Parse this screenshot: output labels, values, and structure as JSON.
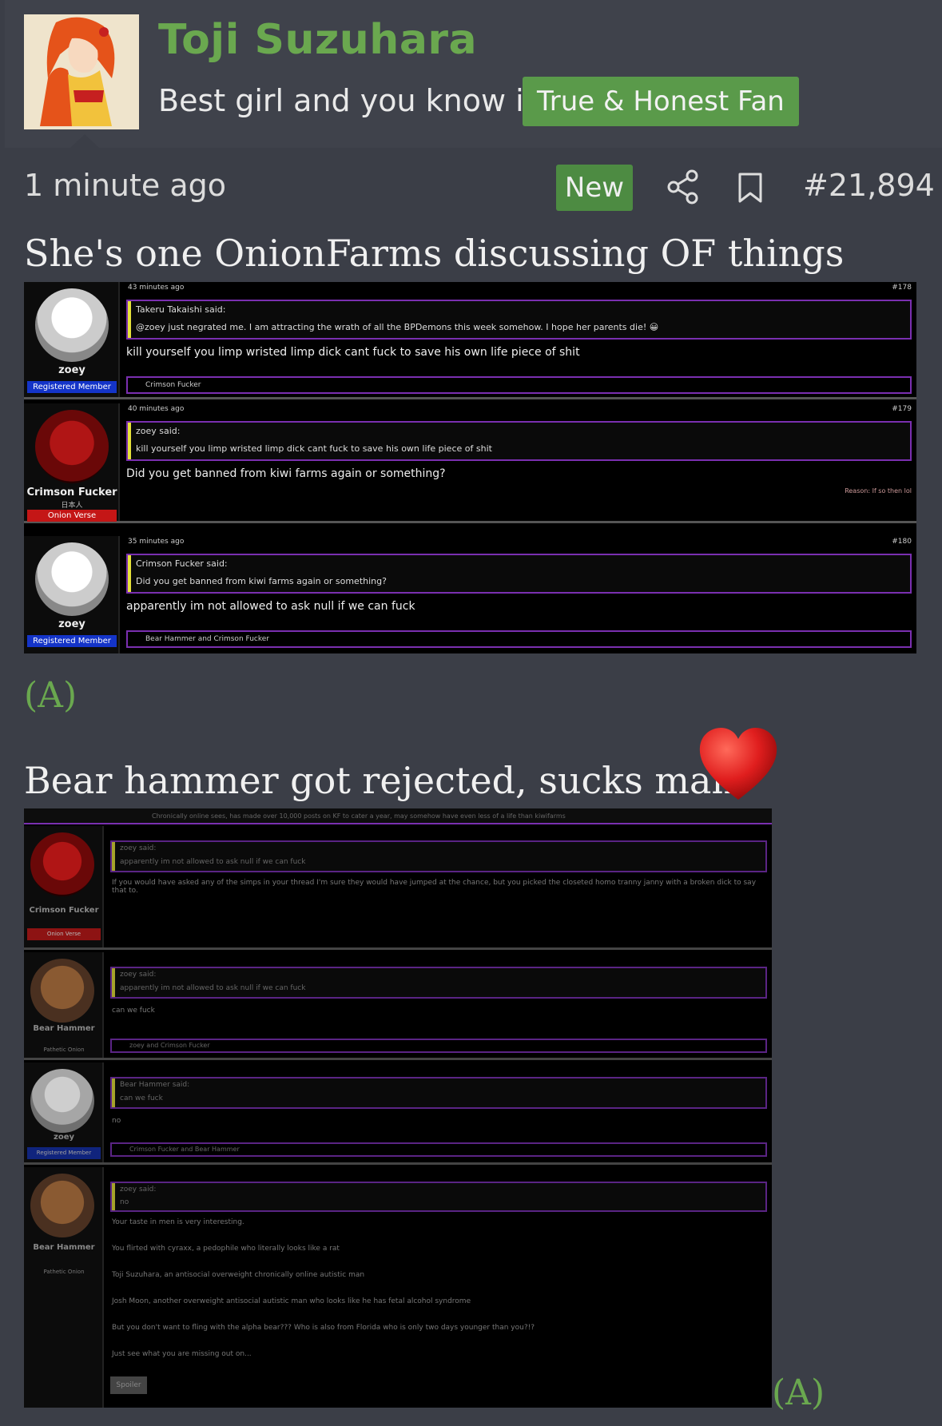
{
  "header": {
    "username": "Toji Suzuhara",
    "user_title": "Best girl and you know it",
    "user_banner": "True & Honest Fan"
  },
  "post": {
    "timestamp": "1 minute ago",
    "new_badge": "New",
    "post_number": "#21,894",
    "line1": "She's one OnionFarms discussing OF things",
    "marker": "(A)",
    "line2": "Bear hammer got rejected, sucks man"
  },
  "screenshot1": {
    "posts": [
      {
        "time": "43 minutes ago",
        "number": "#178",
        "user": "zoey",
        "badge": "Registered Member",
        "quote_author": "Takeru Takaishi said:",
        "quote_text": "@zoey just negrated me. I am attracting the wrath of all the BPDemons this week somehow. I hope her parents die! 😀",
        "text": "kill yourself you limp wristed limp dick cant fuck to save his own life piece of shit",
        "reactions": "Crimson Fucker"
      },
      {
        "time": "40 minutes ago",
        "number": "#179",
        "user": "Crimson Fucker",
        "user_sub": "日本人",
        "badge": "Onion Verse",
        "quote_author": "zoey said:",
        "quote_text": "kill yourself you limp wristed limp dick cant fuck to save his own life piece of shit",
        "text": "Did you get banned from kiwi farms again or something?",
        "reason": "Reason: If so then lol"
      },
      {
        "time": "35 minutes ago",
        "number": "#180",
        "user": "zoey",
        "badge": "Registered Member",
        "quote_author": "Crimson Fucker said:",
        "quote_text": "Did you get banned from kiwi farms again or something?",
        "text": "apparently im not allowed to ask null if we can fuck",
        "reactions": "Bear Hammer and Crimson Fucker"
      }
    ]
  },
  "screenshot2": {
    "top_bar": "Chronically online sees, has made over 10,000 posts on KF to cater a year, may somehow have even less of a life than kiwifarms",
    "posts": [
      {
        "user": "Crimson Fucker",
        "badge": "Onion Verse",
        "quote_author": "zoey said:",
        "quote_text": "apparently im not allowed to ask null if we can fuck",
        "text": "If you would have asked any of the simps in your thread I'm sure they would have jumped at the chance, but you picked the closeted homo tranny janny with a broken dick to say that to."
      },
      {
        "user": "Bear Hammer",
        "badge": "Pathetic Onion",
        "quote_author": "zoey said:",
        "quote_text": "apparently im not allowed to ask null if we can fuck",
        "text": "can we fuck",
        "reactions": "zoey and Crimson Fucker"
      },
      {
        "user": "zoey",
        "badge": "Registered Member",
        "quote_author": "Bear Hammer said:",
        "quote_text": "can we fuck",
        "text": "no",
        "reactions": "Crimson Fucker and Bear Hammer"
      },
      {
        "user": "Bear Hammer",
        "badge": "Pathetic Onion",
        "quote_author": "zoey said:",
        "quote_text": "no",
        "lines": [
          "Your taste in men is very interesting.",
          "You flirted with cyraxx, a pedophile who literally looks like a rat",
          "Toji Suzuhara, an antisocial overweight chronically online autistic man",
          "Josh Moon, another overweight antisocial autistic man who looks like he has fetal alcohol syndrome",
          "But you don't want to fling with the alpha bear??? Who is also from Florida who is only two days younger than you?!?",
          "Just see what you are missing out on..."
        ],
        "spoiler": "Spoiler"
      }
    ]
  },
  "colors": {
    "accent_green": "#6aa84f",
    "banner_green": "#5a9a4a",
    "bg": "#3b3e47",
    "header_bg": "#3f424b"
  }
}
